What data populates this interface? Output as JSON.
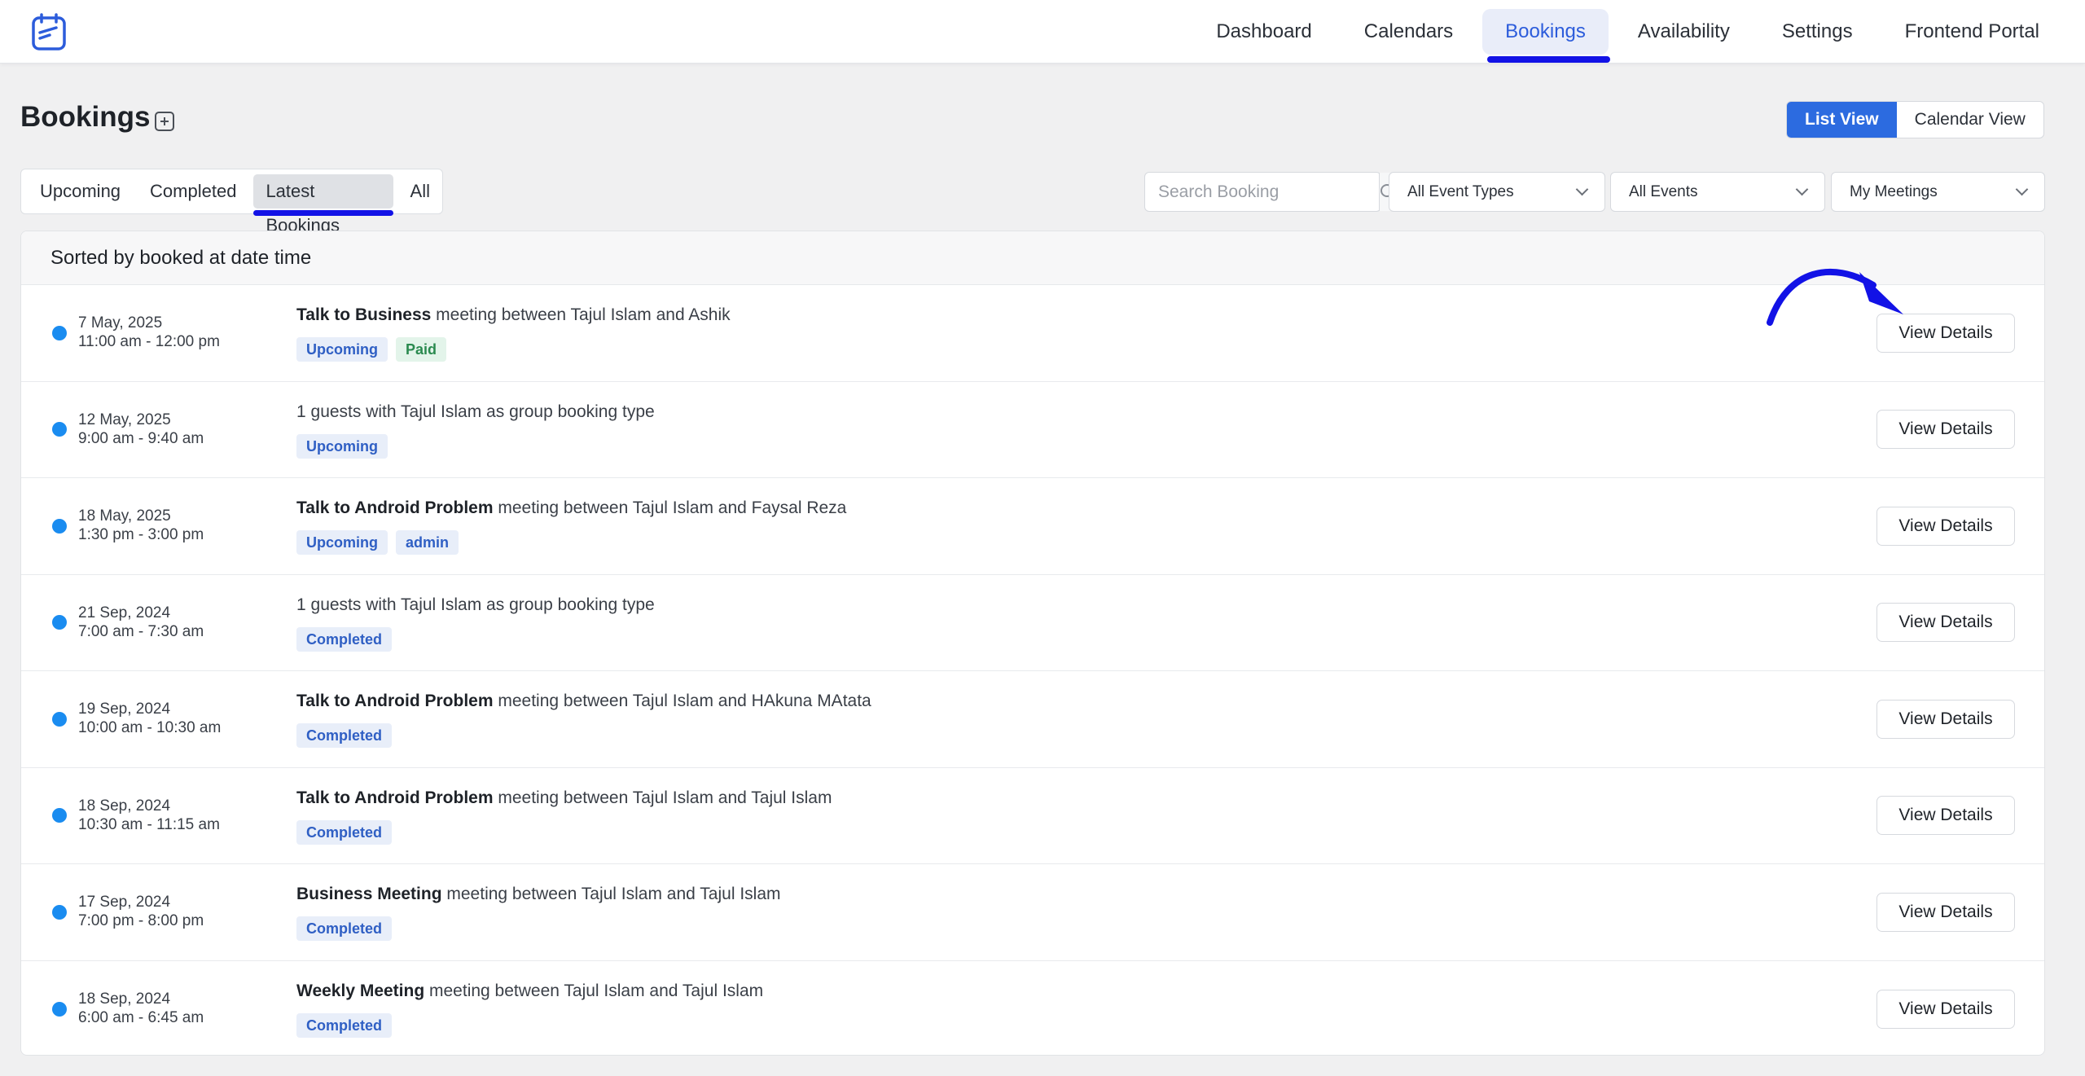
{
  "nav": {
    "items": [
      {
        "label": "Dashboard"
      },
      {
        "label": "Calendars"
      },
      {
        "label": "Bookings"
      },
      {
        "label": "Availability"
      },
      {
        "label": "Settings"
      },
      {
        "label": "Frontend Portal"
      }
    ],
    "active": "Bookings"
  },
  "page": {
    "title": "Bookings",
    "view_toggle": {
      "list": "List View",
      "calendar": "Calendar View",
      "active": "List View"
    }
  },
  "tabs": {
    "items": [
      {
        "label": "Upcoming"
      },
      {
        "label": "Completed"
      },
      {
        "label": "Latest Bookings"
      },
      {
        "label": "All"
      }
    ],
    "active": "Latest Bookings"
  },
  "filters": {
    "search_placeholder": "Search Booking",
    "event_types": "All Event Types",
    "events": "All Events",
    "meetings": "My Meetings"
  },
  "list": {
    "header": "Sorted by booked at date time",
    "button_label": "View Details",
    "rows": [
      {
        "date": "7 May, 2025",
        "time": "11:00 am - 12:00 pm",
        "bold": "Talk to Business",
        "rest": " meeting between Tajul Islam and Ashik",
        "badges": [
          {
            "text": "Upcoming",
            "kind": "upcoming"
          },
          {
            "text": "Paid",
            "kind": "paid"
          }
        ]
      },
      {
        "date": "12 May, 2025",
        "time": "9:00 am - 9:40 am",
        "bold": "",
        "rest": "1 guests with Tajul Islam as group booking type",
        "badges": [
          {
            "text": "Upcoming",
            "kind": "upcoming"
          }
        ]
      },
      {
        "date": "18 May, 2025",
        "time": "1:30 pm - 3:00 pm",
        "bold": "Talk to Android Problem",
        "rest": " meeting between Tajul Islam and Faysal Reza",
        "badges": [
          {
            "text": "Upcoming",
            "kind": "upcoming"
          },
          {
            "text": "admin",
            "kind": "admin"
          }
        ]
      },
      {
        "date": "21 Sep, 2024",
        "time": "7:00 am - 7:30 am",
        "bold": "",
        "rest": "1 guests with Tajul Islam as group booking type",
        "badges": [
          {
            "text": "Completed",
            "kind": "completed"
          }
        ]
      },
      {
        "date": "19 Sep, 2024",
        "time": "10:00 am - 10:30 am",
        "bold": "Talk to Android Problem",
        "rest": " meeting between Tajul Islam and HAkuna MAtata",
        "badges": [
          {
            "text": "Completed",
            "kind": "completed"
          }
        ]
      },
      {
        "date": "18 Sep, 2024",
        "time": "10:30 am - 11:15 am",
        "bold": "Talk to Android Problem",
        "rest": " meeting between Tajul Islam and Tajul Islam",
        "badges": [
          {
            "text": "Completed",
            "kind": "completed"
          }
        ]
      },
      {
        "date": "17 Sep, 2024",
        "time": "7:00 pm - 8:00 pm",
        "bold": "Business Meeting",
        "rest": " meeting between Tajul Islam and Tajul Islam",
        "badges": [
          {
            "text": "Completed",
            "kind": "completed"
          }
        ]
      },
      {
        "date": "18 Sep, 2024",
        "time": "6:00 am - 6:45 am",
        "bold": "Weekly Meeting",
        "rest": " meeting between Tajul Islam and Tajul Islam",
        "badges": [
          {
            "text": "Completed",
            "kind": "completed"
          }
        ]
      }
    ]
  },
  "colors": {
    "accent": "#2c6be0",
    "annotation": "#1212e6",
    "status_dot": "#1a8cf0"
  },
  "icons": [
    "calendar-logo-icon",
    "plus-square-icon",
    "search-icon",
    "chevron-down-icon",
    "annotation-arrow-icon"
  ]
}
